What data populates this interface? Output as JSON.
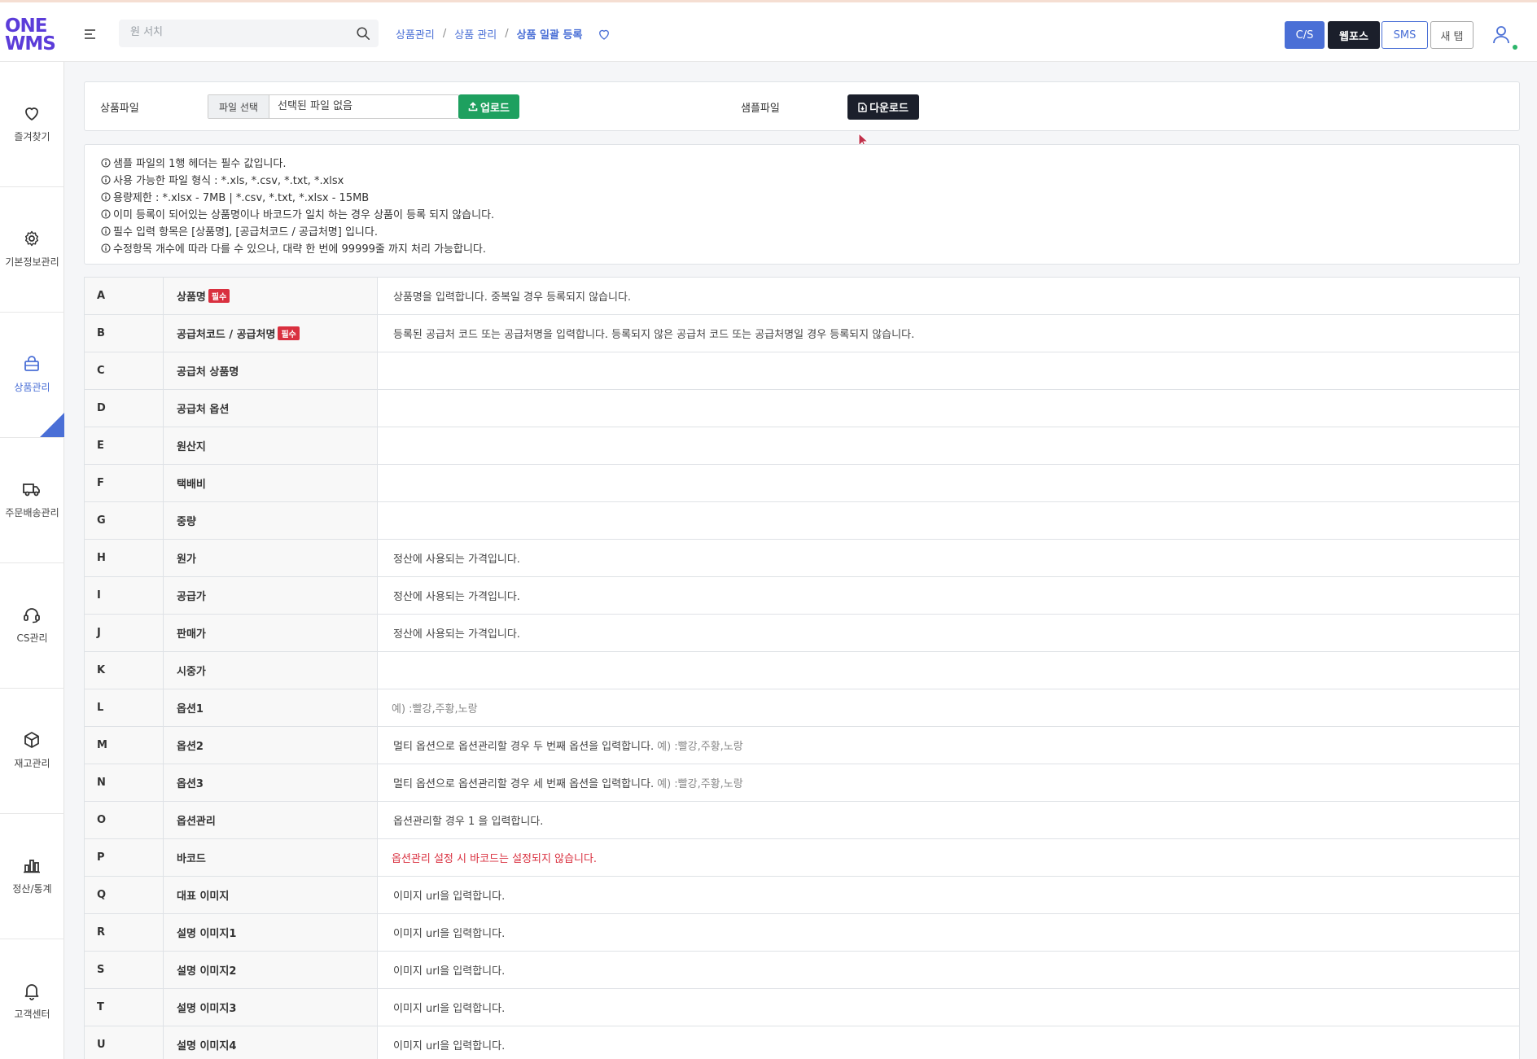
{
  "app": {
    "logo_line1": "ONE",
    "logo_line2": "WMS",
    "brand_color": "#5b3cd9",
    "accent_color": "#4a6fd6"
  },
  "search": {
    "placeholder": "원 서치",
    "value": ""
  },
  "breadcrumb": {
    "items": [
      "상품관리",
      "상품 관리"
    ],
    "current": "상품 일괄 등록"
  },
  "top_buttons": {
    "cs": "C/S",
    "webforce": "웹포스",
    "sms": "SMS",
    "new_tab": "새 탭"
  },
  "sidebar": {
    "items": [
      {
        "label": "즐겨찾기",
        "icon": "heart-icon"
      },
      {
        "label": "기본정보관리",
        "icon": "gear-icon"
      },
      {
        "label": "상품관리",
        "icon": "bag-icon",
        "active": true
      },
      {
        "label": "주문배송관리",
        "icon": "truck-icon"
      },
      {
        "label": "CS관리",
        "icon": "headset-icon"
      },
      {
        "label": "재고관리",
        "icon": "box-icon"
      },
      {
        "label": "정산/통계",
        "icon": "bar-chart-icon"
      },
      {
        "label": "고객센터",
        "icon": "bell-icon"
      }
    ]
  },
  "upload": {
    "product_file_label": "상품파일",
    "file_select_label": "파일 선택",
    "file_name": "선택된 파일 없음",
    "upload_label": "업로드",
    "sample_file_label": "샘플파일",
    "download_label": "다운로드"
  },
  "info_lines": [
    "샘플 파일의 1행 헤더는 필수 값입니다.",
    "사용 가능한 파일 형식 : *.xls, *.csv, *.txt, *.xlsx",
    "용량제한 : *.xlsx - 7MB | *.csv, *.txt, *.xlsx - 15MB",
    "이미 등록이 되어있는 상품명이나 바코드가 일치 하는 경우 상품이 등록 되지 않습니다.",
    "필수 입력 항목은 [상품명], [공급처코드 / 공급처명] 입니다.",
    "수정항목 개수에 따라 다를 수 있으나, 대략 한 번에 99999줄 까지 처리 가능합니다."
  ],
  "required_badge": "필수",
  "columns": [
    {
      "letter": "A",
      "name": "상품명",
      "required": true,
      "desc": "상품명을 입력합니다. 중복일 경우 등록되지 않습니다.",
      "note": "",
      "warning": ""
    },
    {
      "letter": "B",
      "name": "공급처코드 / 공급처명",
      "required": true,
      "desc": "등록된 공급처 코드 또는 공급처명을 입력합니다. 등록되지 않은 공급처 코드 또는 공급처명일 경우 등록되지 않습니다.",
      "note": "",
      "warning": ""
    },
    {
      "letter": "C",
      "name": "공급처 상품명",
      "required": false,
      "desc": "",
      "note": "",
      "warning": ""
    },
    {
      "letter": "D",
      "name": "공급처 옵션",
      "required": false,
      "desc": "",
      "note": "",
      "warning": ""
    },
    {
      "letter": "E",
      "name": "원산지",
      "required": false,
      "desc": "",
      "note": "",
      "warning": ""
    },
    {
      "letter": "F",
      "name": "택배비",
      "required": false,
      "desc": "",
      "note": "",
      "warning": ""
    },
    {
      "letter": "G",
      "name": "중량",
      "required": false,
      "desc": "",
      "note": "",
      "warning": ""
    },
    {
      "letter": "H",
      "name": "원가",
      "required": false,
      "desc": "정산에 사용되는 가격입니다.",
      "note": "",
      "warning": ""
    },
    {
      "letter": "I",
      "name": "공급가",
      "required": false,
      "desc": "정산에 사용되는 가격입니다.",
      "note": "",
      "warning": ""
    },
    {
      "letter": "J",
      "name": "판매가",
      "required": false,
      "desc": "정산에 사용되는 가격입니다.",
      "note": "",
      "warning": ""
    },
    {
      "letter": "K",
      "name": "시중가",
      "required": false,
      "desc": "",
      "note": "",
      "warning": ""
    },
    {
      "letter": "L",
      "name": "옵션1",
      "required": false,
      "desc": "",
      "note": "예) :빨강,주황,노랑",
      "warning": ""
    },
    {
      "letter": "M",
      "name": "옵션2",
      "required": false,
      "desc": "멀티 옵션으로 옵션관리할 경우 두 번째 옵션을 입력합니다.",
      "note": "예) :빨강,주황,노랑",
      "warning": ""
    },
    {
      "letter": "N",
      "name": "옵션3",
      "required": false,
      "desc": "멀티 옵션으로 옵션관리할 경우 세 번째 옵션을 입력합니다.",
      "note": "예) :빨강,주황,노랑",
      "warning": ""
    },
    {
      "letter": "O",
      "name": "옵션관리",
      "required": false,
      "desc": "옵션관리할 경우 1 을 입력합니다.",
      "note": "",
      "warning": ""
    },
    {
      "letter": "P",
      "name": "바코드",
      "required": false,
      "desc": "",
      "note": "",
      "warning": "옵션관리 설정 시 바코드는 설정되지 않습니다."
    },
    {
      "letter": "Q",
      "name": "대표 이미지",
      "required": false,
      "desc": "이미지 url을 입력합니다.",
      "note": "",
      "warning": ""
    },
    {
      "letter": "R",
      "name": "설명 이미지1",
      "required": false,
      "desc": "이미지 url을 입력합니다.",
      "note": "",
      "warning": ""
    },
    {
      "letter": "S",
      "name": "설명 이미지2",
      "required": false,
      "desc": "이미지 url을 입력합니다.",
      "note": "",
      "warning": ""
    },
    {
      "letter": "T",
      "name": "설명 이미지3",
      "required": false,
      "desc": "이미지 url을 입력합니다.",
      "note": "",
      "warning": ""
    },
    {
      "letter": "U",
      "name": "설명 이미지4",
      "required": false,
      "desc": "이미지 url을 입력합니다.",
      "note": "",
      "warning": ""
    }
  ]
}
